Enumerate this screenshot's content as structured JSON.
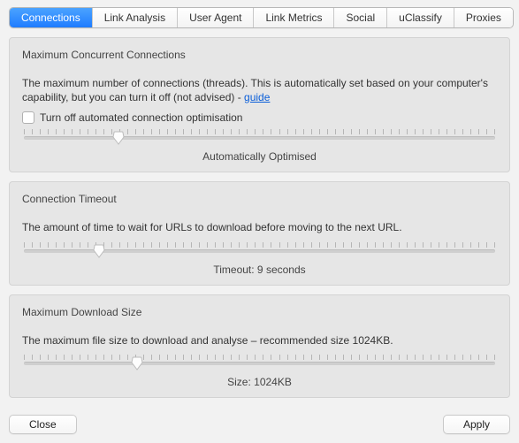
{
  "tabs": {
    "items": [
      {
        "label": "Connections",
        "active": true
      },
      {
        "label": "Link Analysis",
        "active": false
      },
      {
        "label": "User Agent",
        "active": false
      },
      {
        "label": "Link Metrics",
        "active": false
      },
      {
        "label": "Social",
        "active": false
      },
      {
        "label": "uClassify",
        "active": false
      },
      {
        "label": "Proxies",
        "active": false
      }
    ]
  },
  "panels": {
    "concurrent": {
      "title": "Maximum Concurrent Connections",
      "desc_pre": "The maximum number of connections (threads). This is automatically set based on your computer's capability, but you can turn it off (not advised) - ",
      "desc_link": "guide",
      "checkbox_label": "Turn off automated connection optimisation",
      "slider_pos_percent": 20,
      "caption": "Automatically Optimised"
    },
    "timeout": {
      "title": "Connection Timeout",
      "desc": "The amount of time to wait for URLs to download before moving to the next URL.",
      "slider_pos_percent": 16,
      "caption": "Timeout: 9 seconds"
    },
    "download": {
      "title": "Maximum Download Size",
      "desc": "The maximum file size to download and analyse – recommended size 1024KB.",
      "slider_pos_percent": 24,
      "caption": "Size: 1024KB"
    }
  },
  "footer": {
    "close": "Close",
    "apply": "Apply"
  },
  "slider_ticks": 60
}
